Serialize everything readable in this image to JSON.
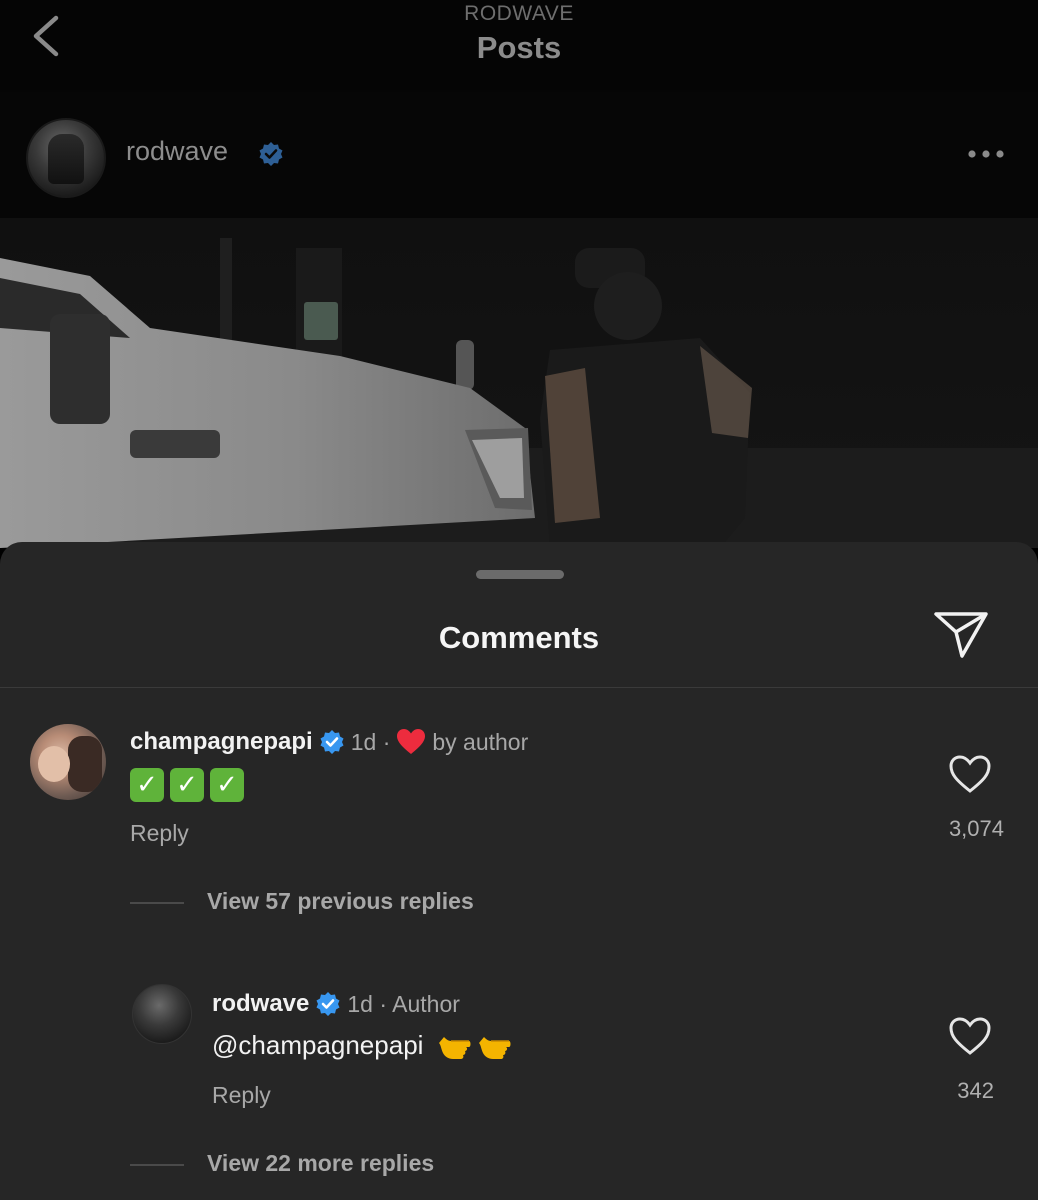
{
  "nav": {
    "username": "RODWAVE",
    "title": "Posts"
  },
  "post": {
    "username": "rodwave",
    "verified": true
  },
  "sheet": {
    "title": "Comments"
  },
  "comments": [
    {
      "username": "champagnepapi",
      "verified": true,
      "time": "1d ·",
      "liked_by": "by author",
      "text_emoji": [
        "✓",
        "✓",
        "✓"
      ],
      "reply_label": "Reply",
      "likes": "3,074",
      "thread_label": "View 57 previous replies"
    },
    {
      "username": "rodwave",
      "verified": true,
      "time": "1d · Author",
      "mention": "@champagnepapi",
      "reply_label": "Reply",
      "likes": "342",
      "thread_label": "View 22 more replies"
    }
  ],
  "colors": {
    "background": "#000000",
    "sheet": "#262626",
    "verified": "#3897f0",
    "heart": "#ed4956",
    "check": "#5fb33a"
  },
  "icons": [
    "back-icon",
    "verified-icon",
    "more-icon",
    "share-icon",
    "heart-icon"
  ]
}
